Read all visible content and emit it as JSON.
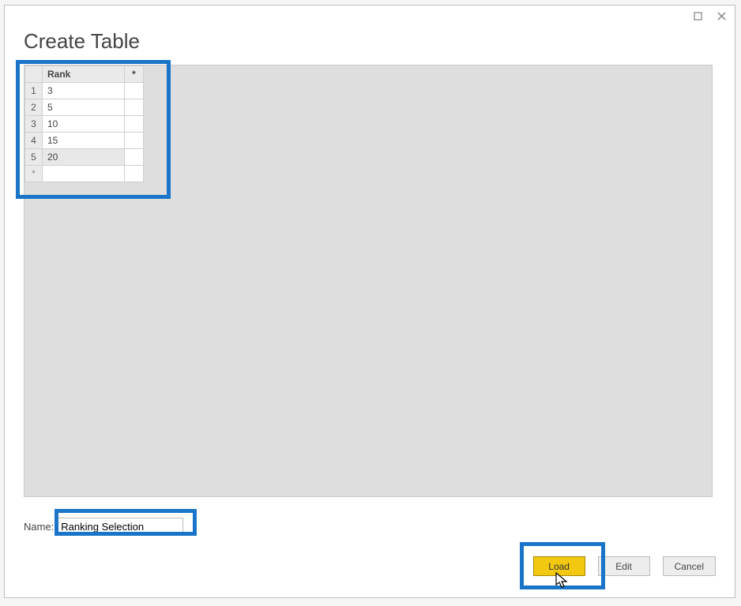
{
  "dialog": {
    "title": "Create Table"
  },
  "table": {
    "header": {
      "rownum": "",
      "rank": "Rank",
      "extra": "*"
    },
    "rows": [
      {
        "num": "1",
        "rank": "3"
      },
      {
        "num": "2",
        "rank": "5"
      },
      {
        "num": "3",
        "rank": "10"
      },
      {
        "num": "4",
        "rank": "15"
      },
      {
        "num": "5",
        "rank": "20"
      }
    ],
    "emptyRowLabel": "*"
  },
  "name_field": {
    "label": "Name:",
    "value": "Ranking Selection"
  },
  "buttons": {
    "load": "Load",
    "edit": "Edit",
    "cancel": "Cancel"
  }
}
